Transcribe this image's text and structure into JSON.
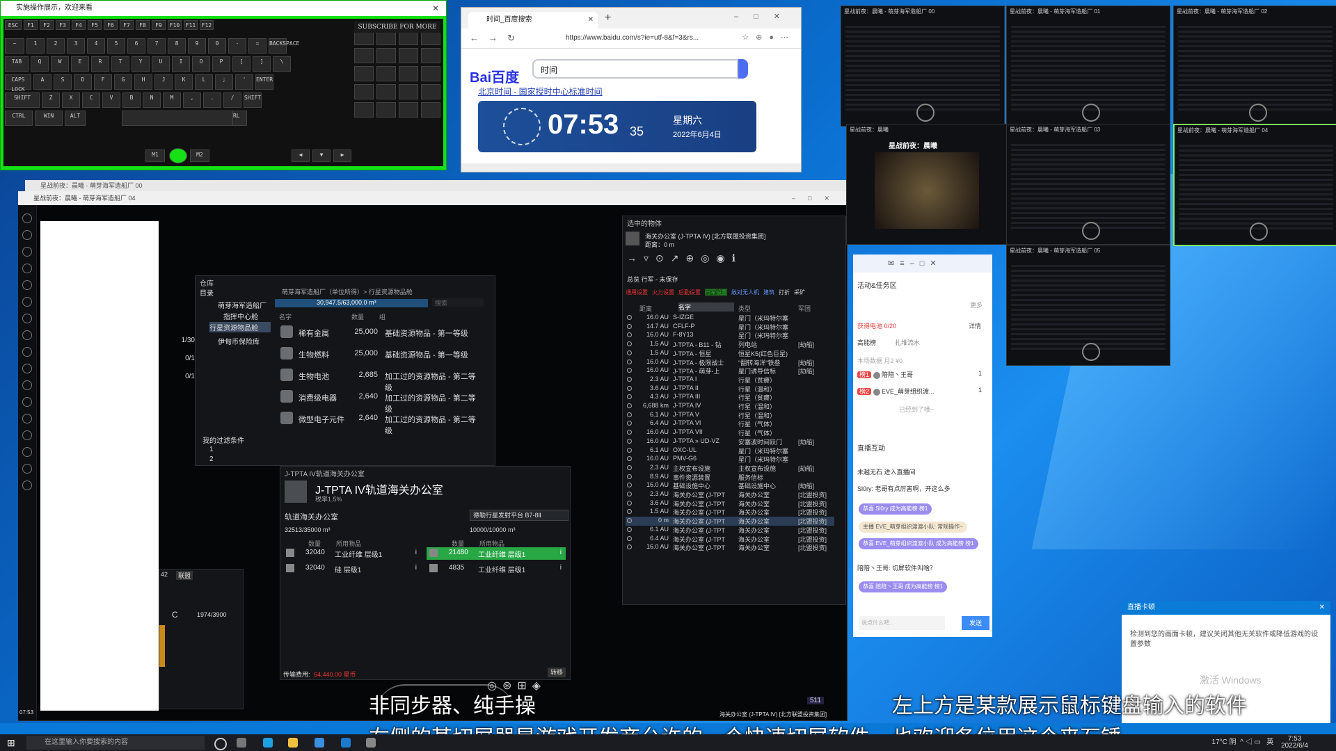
{
  "keyboard_window": {
    "title": "实施操作展示，欢迎来看",
    "subscribe": "SUBSCRIBE FOR MORE",
    "keys_row1": [
      "ESC",
      "F1",
      "F2",
      "F3",
      "F4",
      "F5",
      "F6",
      "F7",
      "F8",
      "F9",
      "F10",
      "F11",
      "F12"
    ],
    "keys_row2": [
      "~",
      "1",
      "2",
      "3",
      "4",
      "5",
      "6",
      "7",
      "8",
      "9",
      "0",
      "-",
      "=",
      "BACKSPACE"
    ],
    "keys_row3": [
      "TAB",
      "Q",
      "W",
      "E",
      "R",
      "T",
      "Y",
      "U",
      "I",
      "O",
      "P",
      "[",
      "]",
      "\\"
    ],
    "keys_row4": [
      "CAPS LOCK",
      "A",
      "S",
      "D",
      "F",
      "G",
      "H",
      "J",
      "K",
      "L",
      ";",
      "'",
      "ENTER"
    ],
    "keys_row5": [
      "SHIFT",
      "Z",
      "X",
      "C",
      "V",
      "B",
      "N",
      "M",
      ",",
      ".",
      "/",
      "SHIFT"
    ],
    "keys_row6": [
      "CTRL",
      "WIN",
      "ALT",
      "ALT",
      "CTRL"
    ],
    "mouse_left": "M1",
    "mouse_right": "M2"
  },
  "browser": {
    "tab_title": "时间_百度搜索",
    "url": "https://www.baidu.com/s?ie=utf-8&f=3&rs...",
    "search_query": "时间",
    "logo_left": "Bai",
    "logo_right": "百度",
    "result_title": "北京时间 - 国家授时中心标准时间",
    "clock_time": "07:53",
    "clock_seconds": "35",
    "clock_weekday": "星期六",
    "clock_date": "2022年6月4日"
  },
  "game": {
    "title_back": "星战前夜：晨曦 - 萌芽海军造船厂 00",
    "title_front": "星战前夜：晨曦 - 萌芽海军造船厂 04",
    "inventory": {
      "header": "仓库",
      "tree_root": "目录",
      "tree_items": [
        "萌芽海军造船厂",
        "指挥中心舱",
        "行星资源物品舱",
        "伊甸币保险库"
      ],
      "breadcrumb": "萌芽海军造船厂（单位所得）> 行星资源物品舱",
      "capacity": "30,947.5/63,000.0 m³",
      "search_placeholder": "搜索",
      "columns": [
        "名字",
        "数量",
        "组"
      ],
      "rows": [
        {
          "name": "稀有金属",
          "qty": "25,000",
          "type": "基础资源物品 - 第一等级"
        },
        {
          "name": "生物燃料",
          "qty": "25,000",
          "type": "基础资源物品 - 第一等级"
        },
        {
          "name": "生物电池",
          "qty": "2,685",
          "type": "加工过的资源物品 - 第二等级"
        },
        {
          "name": "消费级电器",
          "qty": "2,640",
          "type": "加工过的资源物品 - 第二等级"
        },
        {
          "name": "微型电子元件",
          "qty": "2,640",
          "type": "加工过的资源物品 - 第二等级"
        }
      ],
      "filters_label": "我的过滤条件",
      "filters": [
        "1",
        "2"
      ]
    },
    "side_values": [
      "1/30",
      "0/1",
      "0/1"
    ],
    "bottom_left": {
      "tab1": "42",
      "tab2": "联盟",
      "letter": "C",
      "value": "1974/3900"
    },
    "poco": {
      "header": "J-TPTA IV轨道海关办公室",
      "title": "J-TPTA IV轨道海关办公室",
      "tax": "税率1.5%",
      "left_label": "轨道海关办公室",
      "dropdown": "德勒行星发射平台 B7-8Ⅱ",
      "left_capacity": "32513/35000 m³",
      "right_capacity": "10000/10000 m³",
      "col_qty": "数量",
      "col_item": "所用物品",
      "left_rows": [
        {
          "qty": "32040",
          "item": "工业纤维 层级1"
        },
        {
          "qty": "32040",
          "item": "硅 层级1"
        }
      ],
      "right_rows": [
        {
          "qty": "21480",
          "item": "工业纤维 层级1"
        },
        {
          "qty": "4835",
          "item": "工业纤维 层级1"
        }
      ],
      "fee_label": "传输费用:",
      "fee_value": "64,440.00 星币",
      "transfer_button": "转移"
    },
    "selected": {
      "header": "选中的物体",
      "name": "海关办公室 (J-TPTA IV) [北方联盟投资集团]",
      "distance": "距离：0 m"
    },
    "overview": {
      "header": "总览 行军 - 未保存",
      "tabs": [
        "通用设置",
        "火力设置",
        "后勤设置",
        "行军设置",
        "敌对无人机",
        "建筑",
        "打折",
        "采矿"
      ],
      "columns": [
        "距离",
        "名字",
        "类型",
        "军团"
      ],
      "rows": [
        {
          "d": "16.0 AU",
          "n": "S-IZGE",
          "t": "星门（米玛特尔塞",
          "c": ""
        },
        {
          "d": "14.7 AU",
          "n": "CFLF-P",
          "t": "星门（米玛特尔塞",
          "c": ""
        },
        {
          "d": "16.0 AU",
          "n": "F-8Y13",
          "t": "星门（米玛特尔塞",
          "c": ""
        },
        {
          "d": "1.5 AU",
          "n": "J-TPTA - B11 - 钻",
          "t": "列电站",
          "c": "[劫船]"
        },
        {
          "d": "1.5 AU",
          "n": "J-TPTA - 恒星",
          "t": "恒星K5(红色巨星)",
          "c": ""
        },
        {
          "d": "16.0 AU",
          "n": "J-TPTA - 极限战士",
          "t": "\"翻转海洋\"铁叁",
          "c": "[劫船]"
        },
        {
          "d": "16.0 AU",
          "n": "J-TPTA - 萌芽-上",
          "t": "星门诱导信标",
          "c": "[劫船]"
        },
        {
          "d": "2.3 AU",
          "n": "J-TPTA I",
          "t": "行星（贫瘠）",
          "c": ""
        },
        {
          "d": "3.6 AU",
          "n": "J-TPTA II",
          "t": "行星（温和）",
          "c": ""
        },
        {
          "d": "4.3 AU",
          "n": "J-TPTA III",
          "t": "行星（贫瘠）",
          "c": ""
        },
        {
          "d": "6,688 km",
          "n": "J-TPTA IV",
          "t": "行星（温和）",
          "c": ""
        },
        {
          "d": "6.1 AU",
          "n": "J-TPTA V",
          "t": "行星（温和）",
          "c": ""
        },
        {
          "d": "6.4 AU",
          "n": "J-TPTA VI",
          "t": "行星（气体）",
          "c": ""
        },
        {
          "d": "16.0 AU",
          "n": "J-TPTA VII",
          "t": "行星（气体）",
          "c": ""
        },
        {
          "d": "16.0 AU",
          "n": "J-TPTA » UD-VZ",
          "t": "安塞波时间跃门",
          "c": "[劫船]"
        },
        {
          "d": "6.1 AU",
          "n": "OXC-UL",
          "t": "星门（米玛特尔塞",
          "c": ""
        },
        {
          "d": "16.0 AU",
          "n": "PMV-G6",
          "t": "星门（米玛特尔塞",
          "c": ""
        },
        {
          "d": "2.3 AU",
          "n": "主权宣布设施",
          "t": "主权宣布设施",
          "c": "[劫船]"
        },
        {
          "d": "8.9 AU",
          "n": "事件资源装置",
          "t": "服务信标",
          "c": ""
        },
        {
          "d": "16.0 AU",
          "n": "基础设施中心",
          "t": "基础设施中心",
          "c": "[劫船]"
        },
        {
          "d": "2.3 AU",
          "n": "海关办公室 (J-TPT",
          "t": "海关办公室",
          "c": "[北盟投资]"
        },
        {
          "d": "3.6 AU",
          "n": "海关办公室 (J-TPT",
          "t": "海关办公室",
          "c": "[北盟投资]"
        },
        {
          "d": "1.5 AU",
          "n": "海关办公室 (J-TPT",
          "t": "海关办公室",
          "c": "[北盟投资]"
        },
        {
          "d": "0 m",
          "n": "海关办公室 (J-TPT",
          "t": "海关办公室",
          "c": "[北盟投资]"
        },
        {
          "d": "6.1 AU",
          "n": "海关办公室 (J-TPT",
          "t": "海关办公室",
          "c": "[北盟投资]"
        },
        {
          "d": "6.4 AU",
          "n": "海关办公室 (J-TPT",
          "t": "海关办公室",
          "c": "[北盟投资]"
        },
        {
          "d": "16.0 AU",
          "n": "海关办公室 (J-TPT",
          "t": "海关办公室",
          "c": "[北盟投资]"
        }
      ]
    },
    "hud_speed": "511",
    "bottom_target": "海关办公室 (J-TPTA IV) [北方联盟投资集团]",
    "clock": "07:53"
  },
  "thumbnails": [
    "星战前夜：晨曦 - 萌芽海军造船厂 00",
    "星战前夜：晨曦 - 萌芽海军造船厂 01",
    "星战前夜：晨曦 - 萌芽海军造船厂 02",
    "星战前夜：晨曦",
    "星战前夜：晨曦 - 萌芽海军造船厂 03",
    "星战前夜：晨曦 - 萌芽海军造船厂 04",
    "星战前夜：晨曦 - 萌芽海军造船厂 05"
  ],
  "thumb_game_logo": "星战前夜：晨曦",
  "chat": {
    "section1": "活动&任务区",
    "more": "更多",
    "task_label": "获得电池 0/20",
    "task_detail": "详情",
    "rank_label": "高能榜",
    "rank_sub": "扎堆流水",
    "rank_stats": "本场数据 月2 ¥0",
    "ranks": [
      {
        "badge": "榜1",
        "name": "陪陪丶王哥",
        "count": "1"
      },
      {
        "badge": "榜2",
        "name": "EVE_萌芽组织渡...",
        "count": "1"
      }
    ],
    "more_link": "已经到了哦~",
    "section2": "直播互动",
    "messages": [
      "未越无石 进入直播间",
      "Sl0ry: 老哥有点厉害啊，开这么多",
      "恭喜 Sl0ry 成为高能榜 榜1",
      "主播 EVE_萌芽组织渡渡小队: 常规操作~",
      "恭喜 EVE_萌芽组织渡渡小队 成为高能榜 榜1",
      "陪陪丶王哥: 切屏软件叫啥？",
      "恭喜 陪陪丶王哥 成为高能榜 榜1"
    ],
    "input_placeholder": "说点什么吧...",
    "send": "发送"
  },
  "notification": {
    "title": "直播卡顿",
    "body": "检测到您的画面卡顿，建议关闭其他无关软件或降低游戏的设置参数",
    "watermark": "激活 Windows"
  },
  "subtitles": {
    "line1": "非同步器、纯手操",
    "line2": "右侧的某切屏器是游戏开发商允许的一个快速切屏软件",
    "line3": "左上方是某款展示鼠标键盘输入的软件",
    "line4": "也欢迎各位用这个来石锤"
  },
  "taskbar": {
    "search": "在这里输入你要搜索的内容",
    "weather": "17°C 阴",
    "lang": "英",
    "time": "7:53",
    "date": "2022/6/4"
  },
  "colors": {
    "keyboard_green": "#16e016",
    "desktop_blue": "#0a78d7",
    "overview_highlight": "#2a3d55",
    "green_button": "#28a745"
  }
}
